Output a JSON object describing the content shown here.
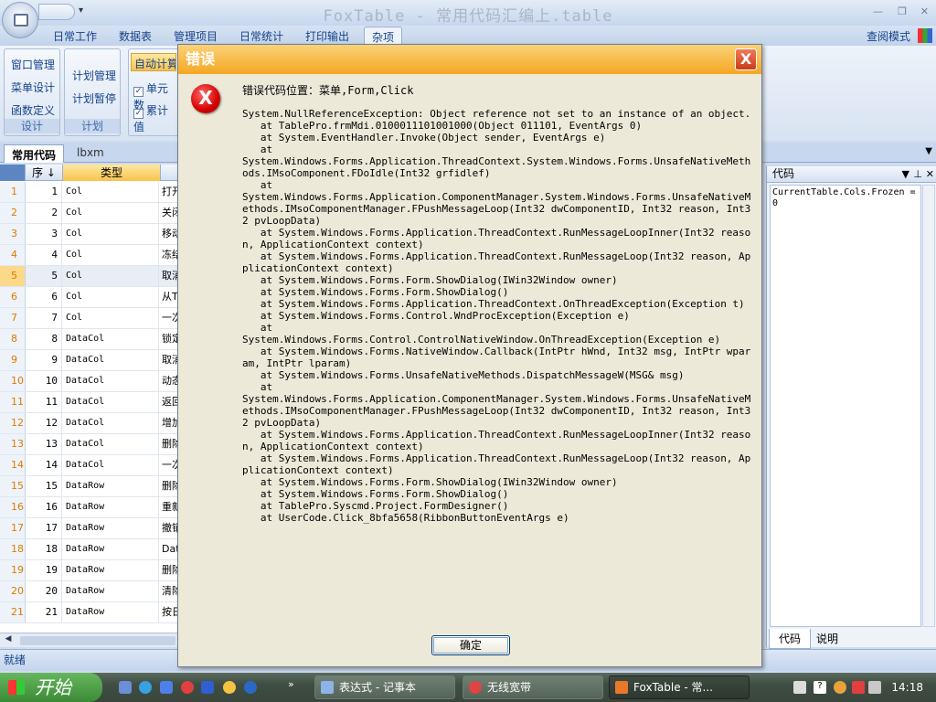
{
  "app": {
    "title": "FoxTable - 常用代码汇编上.table",
    "view_mode_label": "查阅模式"
  },
  "menu_tabs": [
    "日常工作",
    "数据表",
    "管理项目",
    "日常统计",
    "打印输出",
    "杂项"
  ],
  "active_menu_tab": "杂项",
  "ribbon": {
    "group_design": {
      "items": [
        "窗口管理",
        "菜单设计",
        "函数定义"
      ],
      "name": "设计"
    },
    "group_plan": {
      "items": [
        "计划管理",
        "计划暂停"
      ],
      "name": "计划"
    },
    "group_calc": {
      "auto_calc": "自动计算",
      "checks": [
        "单元数",
        "累计值"
      ]
    }
  },
  "doc_tabs": [
    "常用代码",
    "lbxm"
  ],
  "grid": {
    "headers": {
      "seq": "序",
      "type": "类型"
    },
    "rows": [
      {
        "n": "1",
        "seq": "1",
        "type": "Col",
        "desc": "打开"
      },
      {
        "n": "2",
        "seq": "2",
        "type": "Col",
        "desc": "关闭"
      },
      {
        "n": "3",
        "seq": "3",
        "type": "Col",
        "desc": "移动"
      },
      {
        "n": "4",
        "seq": "4",
        "type": "Col",
        "desc": "冻结"
      },
      {
        "n": "5",
        "seq": "5",
        "type": "Col",
        "desc": "取消"
      },
      {
        "n": "6",
        "seq": "6",
        "type": "Col",
        "desc": "从T"
      },
      {
        "n": "7",
        "seq": "7",
        "type": "Col",
        "desc": "一次"
      },
      {
        "n": "8",
        "seq": "8",
        "type": "DataCol",
        "desc": "锁定"
      },
      {
        "n": "9",
        "seq": "9",
        "type": "DataCol",
        "desc": "取消"
      },
      {
        "n": "10",
        "seq": "10",
        "type": "DataCol",
        "desc": "动态"
      },
      {
        "n": "11",
        "seq": "11",
        "type": "DataCol",
        "desc": "返回"
      },
      {
        "n": "12",
        "seq": "12",
        "type": "DataCol",
        "desc": "增加"
      },
      {
        "n": "13",
        "seq": "13",
        "type": "DataCol",
        "desc": "删除"
      },
      {
        "n": "14",
        "seq": "14",
        "type": "DataCol",
        "desc": "一次"
      },
      {
        "n": "15",
        "seq": "15",
        "type": "DataRow",
        "desc": "删除"
      },
      {
        "n": "16",
        "seq": "16",
        "type": "DataRow",
        "desc": "重新"
      },
      {
        "n": "17",
        "seq": "17",
        "type": "DataRow",
        "desc": "撤销"
      },
      {
        "n": "18",
        "seq": "18",
        "type": "DataRow",
        "desc": "Dat"
      },
      {
        "n": "19",
        "seq": "19",
        "type": "DataRow",
        "desc": "删除"
      },
      {
        "n": "20",
        "seq": "20",
        "type": "DataRow",
        "desc": "清除"
      },
      {
        "n": "21",
        "seq": "21",
        "type": "DataRow",
        "desc": "按日"
      }
    ]
  },
  "right_panel": {
    "title": "代码",
    "code": "CurrentTable.Cols.Frozen = 0",
    "tabs": [
      "代码",
      "说明"
    ]
  },
  "status": "就绪",
  "dialog": {
    "title": "错误",
    "location": "错误代码位置：菜单,Form,Click",
    "trace": "System.NullReferenceException: Object reference not set to an instance of an object.\n   at TablePro.frmMdi.0100011101001000(Object 011101, EventArgs 0)\n   at System.EventHandler.Invoke(Object sender, EventArgs e)\n   at\nSystem.Windows.Forms.Application.ThreadContext.System.Windows.Forms.UnsafeNativeMethods.IMsoComponent.FDoIdle(Int32 grfidlef)\n   at\nSystem.Windows.Forms.Application.ComponentManager.System.Windows.Forms.UnsafeNativeMethods.IMsoComponentManager.FPushMessageLoop(Int32 dwComponentID, Int32 reason, Int32 pvLoopData)\n   at System.Windows.Forms.Application.ThreadContext.RunMessageLoopInner(Int32 reason, ApplicationContext context)\n   at System.Windows.Forms.Application.ThreadContext.RunMessageLoop(Int32 reason, ApplicationContext context)\n   at System.Windows.Forms.Form.ShowDialog(IWin32Window owner)\n   at System.Windows.Forms.Form.ShowDialog()\n   at System.Windows.Forms.Application.ThreadContext.OnThreadException(Exception t)\n   at System.Windows.Forms.Control.WndProcException(Exception e)\n   at\nSystem.Windows.Forms.Control.ControlNativeWindow.OnThreadException(Exception e)\n   at System.Windows.Forms.NativeWindow.Callback(IntPtr hWnd, Int32 msg, IntPtr wparam, IntPtr lparam)\n   at System.Windows.Forms.UnsafeNativeMethods.DispatchMessageW(MSG& msg)\n   at\nSystem.Windows.Forms.Application.ComponentManager.System.Windows.Forms.UnsafeNativeMethods.IMsoComponentManager.FPushMessageLoop(Int32 dwComponentID, Int32 reason, Int32 pvLoopData)\n   at System.Windows.Forms.Application.ThreadContext.RunMessageLoopInner(Int32 reason, ApplicationContext context)\n   at System.Windows.Forms.Application.ThreadContext.RunMessageLoop(Int32 reason, ApplicationContext context)\n   at System.Windows.Forms.Form.ShowDialog(IWin32Window owner)\n   at System.Windows.Forms.Form.ShowDialog()\n   at TablePro.Syscmd.Project.FormDesigner()\n   at UserCode.Click_8bfa5658(RibbonButtonEventArgs e)",
    "ok_label": "确定",
    "close_glyph": "X",
    "error_glyph": "X"
  },
  "taskbar": {
    "start_label": "开始",
    "quick_more": "»",
    "buttons": [
      "表达式 - 记事本",
      "无线宽带",
      "FoxTable - 常..."
    ],
    "clock": "14:18"
  },
  "icons": {
    "orb": "app-menu-icon",
    "error": "error-icon",
    "colors": {
      "accent": "#15428b",
      "dialog_title": "#f5a623",
      "row_number": "#e07a00"
    }
  }
}
